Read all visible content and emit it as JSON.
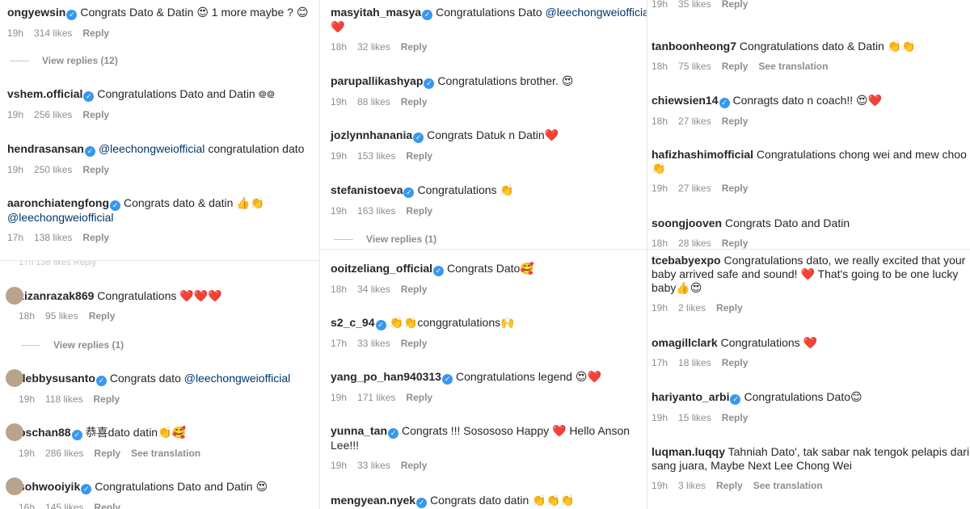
{
  "labels": {
    "likes_suffix": "likes",
    "reply": "Reply",
    "see_translation": "See translation"
  },
  "col1": {
    "comments": [
      {
        "user": "ongyewsin",
        "verified": true,
        "text": "Congrats Dato & Datin 😍 1 more maybe ? 😊",
        "time": "19h",
        "likes": "314 likes",
        "reply": "Reply"
      },
      {
        "user": "vshem.official",
        "verified": true,
        "text": "Congratulations Dato and Datin ᪤᪤",
        "time": "19h",
        "likes": "256 likes",
        "reply": "Reply"
      },
      {
        "user": "hendrasansan",
        "verified": true,
        "mention": "@leechongweiofficial",
        "text": "congratulation dato",
        "time": "19h",
        "likes": "250 likes",
        "reply": "Reply"
      },
      {
        "user": "aaronchiatengfong",
        "verified": true,
        "text": "Congrats dato & datin 👍👏",
        "mention2": "@leechongweiofficial",
        "time": "17h",
        "likes": "138 likes",
        "reply": "Reply"
      }
    ],
    "view_replies": "View replies (12)"
  },
  "col1b": {
    "ghost": "17h   138 likes   Reply",
    "comments": [
      {
        "user": "zizanrazak869",
        "verified": false,
        "text": "Congratulations ❤️❤️❤️",
        "time": "18h",
        "likes": "95 likes",
        "reply": "Reply"
      },
      {
        "user": "debbysusanto",
        "verified": true,
        "text": "Congrats dato",
        "mention": "@leechongweiofficial",
        "time": "19h",
        "likes": "118 likes",
        "reply": "Reply"
      },
      {
        "user": "pschan88",
        "verified": true,
        "text": "恭喜dato datin👏🥰",
        "time": "19h",
        "likes": "286 likes",
        "reply": "Reply",
        "translate": "See translation"
      },
      {
        "user": "sohwooiyik",
        "verified": true,
        "text": "Congratulations Dato and Datin 😍",
        "time": "16h",
        "likes": "145 likes",
        "reply": "Reply"
      }
    ],
    "view_replies": "View replies (1)"
  },
  "col2": {
    "comments": [
      {
        "user": "masyitah_masya",
        "verified": true,
        "text": "Congratulations Dato",
        "mention": "@leechongweiofficial",
        "emoji_line": "❤️",
        "time": "18h",
        "likes": "32 likes",
        "reply": "Reply"
      },
      {
        "user": "parupallikashyap",
        "verified": true,
        "text": "Congratulations brother. 😍",
        "time": "19h",
        "likes": "88 likes",
        "reply": "Reply"
      },
      {
        "user": "jozlynnhanania",
        "verified": true,
        "text": "Congrats Datuk n Datin❤️",
        "time": "19h",
        "likes": "153 likes",
        "reply": "Reply"
      },
      {
        "user": "stefanistoeva",
        "verified": true,
        "text": "Congratulations 👏",
        "time": "19h",
        "likes": "163 likes",
        "reply": "Reply"
      }
    ],
    "view_replies": "View replies (1)"
  },
  "col2b": {
    "comments": [
      {
        "user": "ooitzeliang_official",
        "verified": true,
        "text": "Congrats Dato🥰",
        "time": "18h",
        "likes": "34 likes",
        "reply": "Reply"
      },
      {
        "user": "s2_c_94",
        "verified": true,
        "text": "👏👏conggratulations🙌",
        "time": "17h",
        "likes": "33 likes",
        "reply": "Reply"
      },
      {
        "user": "yang_po_han940313",
        "verified": true,
        "text": "Congratulations legend 😍❤️",
        "time": "19h",
        "likes": "171 likes",
        "reply": "Reply"
      },
      {
        "user": "yunna_tan",
        "verified": true,
        "text": "Congrats !!! Sosososo Happy ❤️ Hello Anson",
        "text2": "Lee!!!",
        "time": "19h",
        "likes": "33 likes",
        "reply": "Reply"
      },
      {
        "user": "mengyean.nyek",
        "verified": true,
        "text": "Congrats dato datin 👏👏👏",
        "time": "",
        "likes": "",
        "reply": ""
      }
    ]
  },
  "col3": {
    "top_meta": {
      "time": "19h",
      "likes": "35 likes",
      "reply": "Reply"
    },
    "comments": [
      {
        "user": "tanboonheong7",
        "verified": false,
        "text": "Congratulations dato & Datin 👏👏",
        "time": "18h",
        "likes": "75 likes",
        "reply": "Reply",
        "translate": "See translation"
      },
      {
        "user": "chiewsien14",
        "verified": true,
        "text": "Conragts dato n coach!! 😍❤️",
        "time": "18h",
        "likes": "27 likes",
        "reply": "Reply"
      },
      {
        "user": "hafizhashimofficial",
        "verified": false,
        "text": "Congratulations chong wei and mew choo",
        "text2": "👏",
        "time": "19h",
        "likes": "27 likes",
        "reply": "Reply"
      },
      {
        "user": "soongjooven",
        "verified": false,
        "text": "Congrats Dato and Datin",
        "time": "18h",
        "likes": "28 likes",
        "reply": "Reply"
      }
    ]
  },
  "col3b": {
    "comments": [
      {
        "user": "tcebabyexpo",
        "verified": false,
        "text": "Congratulations dato, we really excited that your",
        "text2": "baby arrived safe and sound! ❤️ That's going to be one lucky",
        "text3": "baby👍😍",
        "time": "19h",
        "likes": "2 likes",
        "reply": "Reply"
      },
      {
        "user": "omagillclark",
        "verified": false,
        "text": "Congratulations ❤️",
        "time": "17h",
        "likes": "18 likes",
        "reply": "Reply"
      },
      {
        "user": "hariyanto_arbi",
        "verified": true,
        "text": "Congratulations Dato😊",
        "time": "19h",
        "likes": "15 likes",
        "reply": "Reply"
      },
      {
        "user": "luqman.luqqy",
        "verified": false,
        "text": "Tahniah Dato', tak sabar nak tengok pelapis dari",
        "text2": "sang juara, Maybe Next Lee Chong Wei",
        "time": "19h",
        "likes": "3 likes",
        "reply": "Reply",
        "translate": "See translation"
      }
    ]
  }
}
